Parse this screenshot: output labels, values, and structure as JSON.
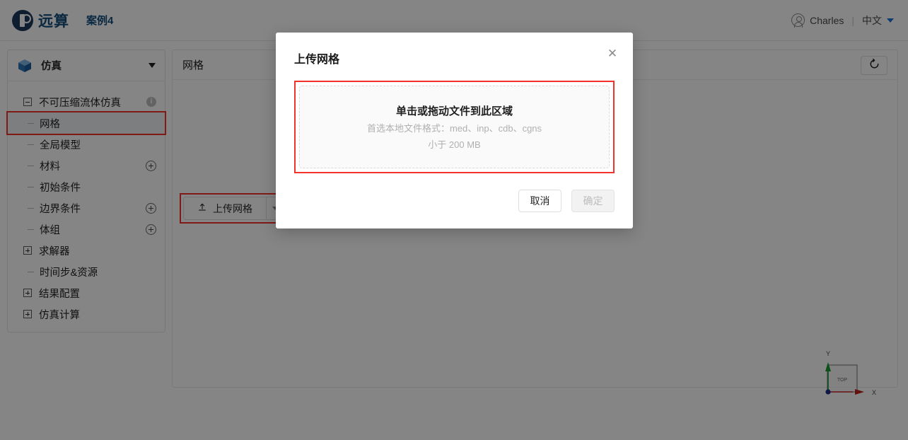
{
  "header": {
    "logo_text": "远算",
    "logo_icon": "yuansuan-logo-icon",
    "case_title": "案例4",
    "user_name": "Charles",
    "user_icon": "user-circle-icon",
    "divider": "|",
    "language": "中文",
    "caret_icon": "chevron-down-icon"
  },
  "sidebar": {
    "header_label": "仿真",
    "header_icon": "blue-cube-icon",
    "header_caret_icon": "chevron-down-icon",
    "tree": [
      {
        "label": "不可压缩流体仿真",
        "level": 0,
        "toggle": "minus",
        "trailing": "info",
        "selected": false
      },
      {
        "label": "网格",
        "level": 1,
        "toggle": "tick",
        "trailing": "none",
        "selected": true
      },
      {
        "label": "全局模型",
        "level": 1,
        "toggle": "tick",
        "trailing": "none",
        "selected": false
      },
      {
        "label": "材料",
        "level": 1,
        "toggle": "tick",
        "trailing": "plus",
        "selected": false
      },
      {
        "label": "初始条件",
        "level": 1,
        "toggle": "tick",
        "trailing": "none",
        "selected": false
      },
      {
        "label": "边界条件",
        "level": 1,
        "toggle": "tick",
        "trailing": "plus",
        "selected": false
      },
      {
        "label": "体组",
        "level": 1,
        "toggle": "tick",
        "trailing": "plus",
        "selected": false
      },
      {
        "label": "求解器",
        "level": 0,
        "toggle": "plus",
        "trailing": "none",
        "selected": false
      },
      {
        "label": "时间步&资源",
        "level": 1,
        "toggle": "tick",
        "trailing": "none",
        "selected": false
      },
      {
        "label": "结果配置",
        "level": 0,
        "toggle": "plus",
        "trailing": "none",
        "selected": false
      },
      {
        "label": "仿真计算",
        "level": 0,
        "toggle": "plus",
        "trailing": "none",
        "selected": false
      }
    ]
  },
  "content": {
    "panel_title": "网格",
    "refresh_icon": "refresh-icon",
    "upload_button_label": "上传网格",
    "upload_button_icon": "upload-icon",
    "upload_dropdown_icon": "chevron-down-icon"
  },
  "axis_widget": {
    "x_label": "X",
    "y_label": "Y",
    "face_label": "TOP",
    "x_color": "#c0201c",
    "y_color": "#1a9c2e",
    "origin_color": "#1a2f8c"
  },
  "modal": {
    "title": "上传网格",
    "close_icon": "close-icon",
    "dropzone": {
      "main_text": "单击或拖动文件到此区域",
      "format_text": "首选本地文件格式：med、inp、cdb、cgns",
      "size_text": "小于 200 MB"
    },
    "cancel_label": "取消",
    "confirm_label": "确定"
  },
  "highlights": {
    "color": "#f4322c"
  }
}
